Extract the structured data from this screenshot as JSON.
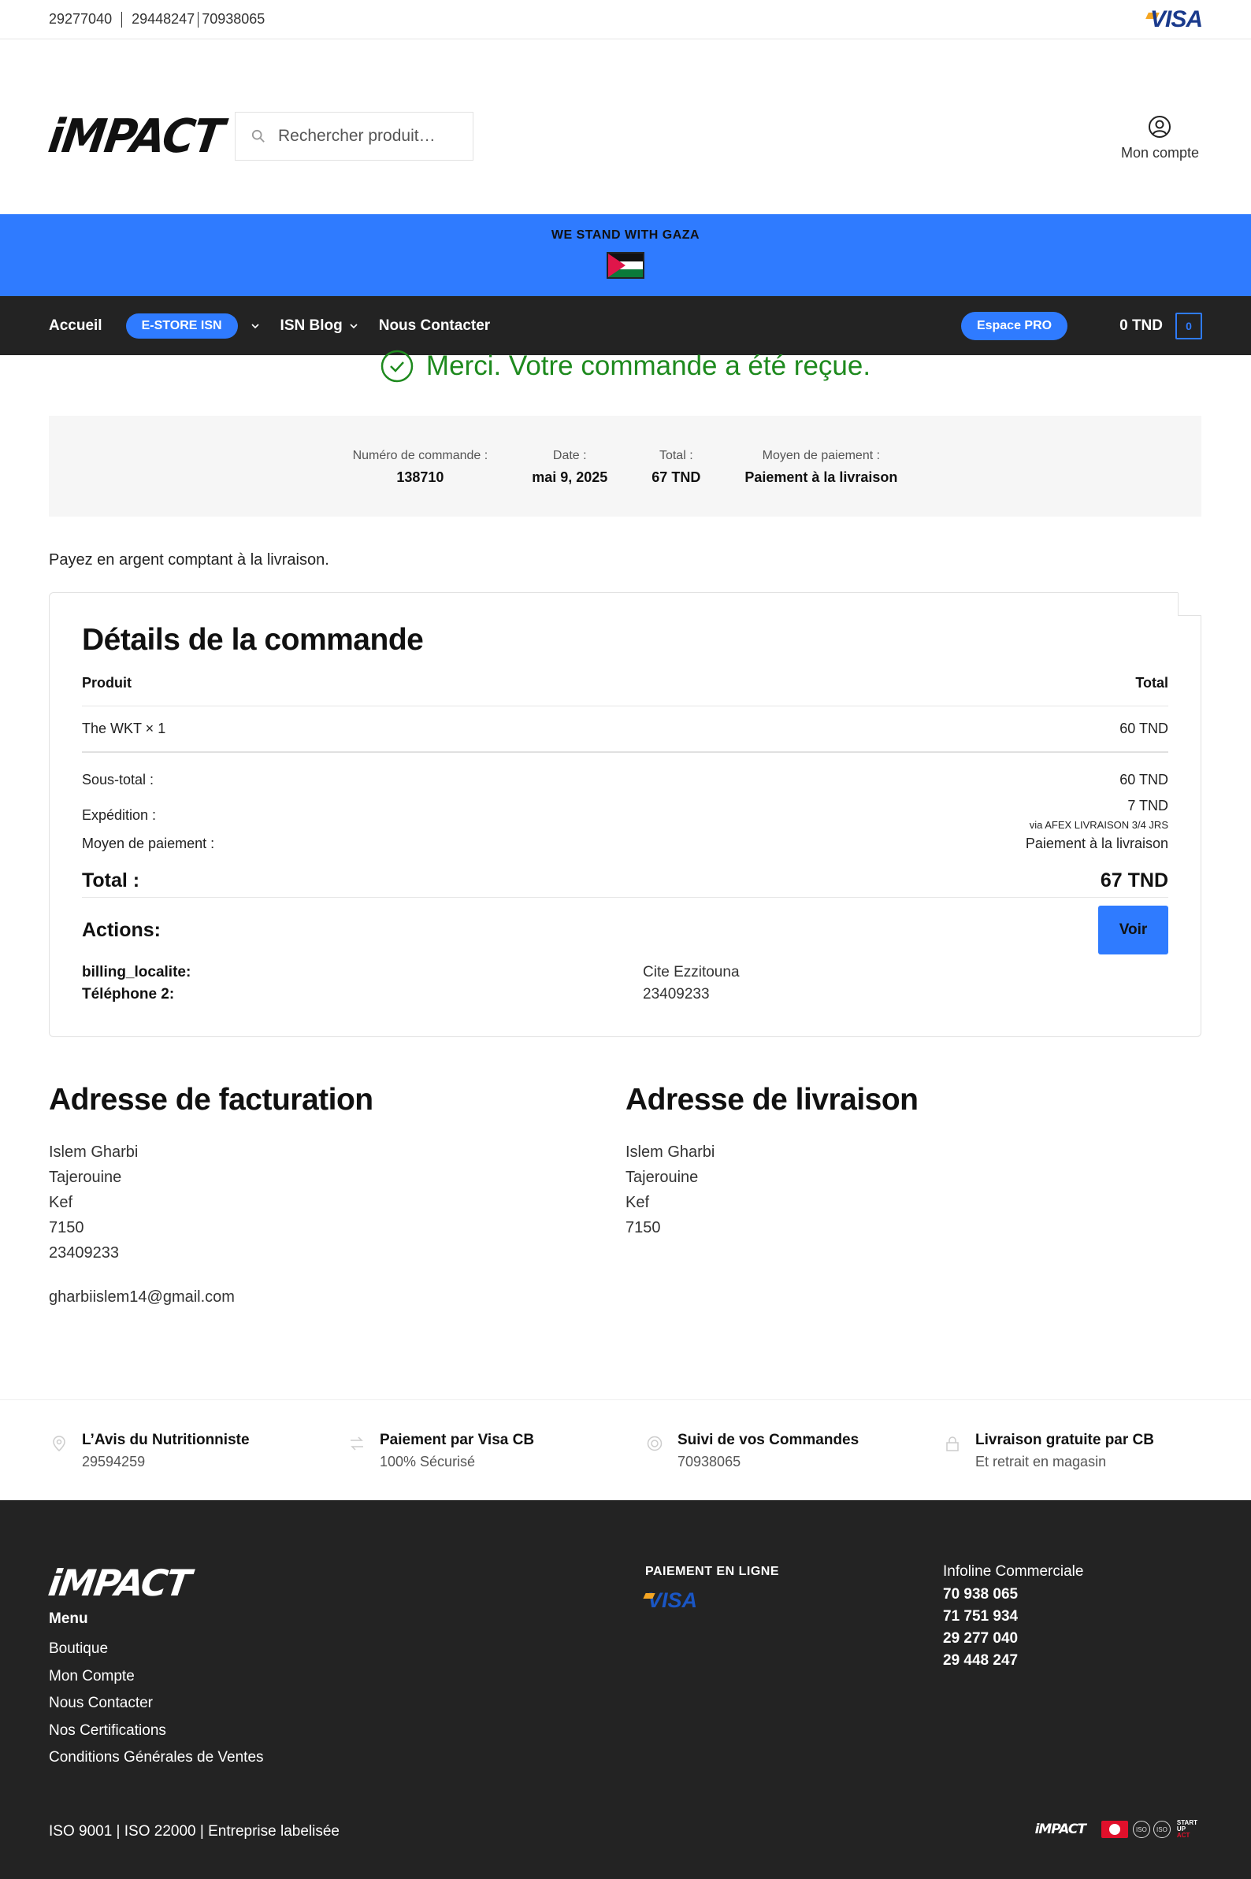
{
  "topbar": {
    "phones": [
      "29277040",
      "29448247",
      "70938065"
    ],
    "visa": "VISA"
  },
  "header": {
    "logo": "iMPACT",
    "search_placeholder": "Rechercher produit…",
    "account_label": "Mon compte"
  },
  "banner": {
    "text": "WE STAND WITH GAZA"
  },
  "nav": {
    "home": "Accueil",
    "estore": "E-STORE ISN",
    "blog": "ISN Blog",
    "contact": "Nous Contacter",
    "espace_pro": "Espace PRO",
    "cart_total": "0 TND",
    "cart_count": "0"
  },
  "order": {
    "thanks": "Merci. Votre commande a été reçue.",
    "summary": [
      {
        "label": "Numéro de commande :",
        "value": "138710"
      },
      {
        "label": "Date :",
        "value": "mai 9, 2025"
      },
      {
        "label": "Total :",
        "value": "67 TND"
      },
      {
        "label": "Moyen de paiement :",
        "value": "Paiement à la livraison"
      }
    ],
    "pay_note": "Payez en argent comptant à la livraison."
  },
  "details": {
    "title": "Détails de la commande",
    "col_product": "Produit",
    "col_total": "Total",
    "item_name": "The WKT × 1",
    "item_total": "60 TND",
    "subtotal_label": "Sous-total :",
    "subtotal_value": "60 TND",
    "shipping_label": "Expédition :",
    "shipping_value": "7 TND",
    "shipping_via": "via AFEX LIVRAISON 3/4 JRS",
    "payment_label": "Moyen de paiement :",
    "payment_value": "Paiement à la livraison",
    "total_label": "Total :",
    "total_value": "67 TND",
    "actions_label": "Actions:",
    "voir": "Voir",
    "meta": [
      {
        "key": "billing_localite:",
        "value": "Cite Ezzitouna"
      },
      {
        "key": "Téléphone 2:",
        "value": "23409233"
      }
    ]
  },
  "billing": {
    "title": "Adresse de facturation",
    "name": "Islem Gharbi",
    "city": "Tajerouine",
    "region": "Kef",
    "zip": "7150",
    "phone": "23409233",
    "email": "gharbiislem14@gmail.com"
  },
  "shipping": {
    "title": "Adresse de livraison",
    "name": "Islem Gharbi",
    "city": "Tajerouine",
    "region": "Kef",
    "zip": "7150"
  },
  "features": [
    {
      "icon": "map-pin-icon",
      "title": "L’Avis du Nutritionniste",
      "sub": "29594259"
    },
    {
      "icon": "exchange-icon",
      "title": "Paiement par Visa CB",
      "sub": "100% Sécurisé"
    },
    {
      "icon": "target-icon",
      "title": "Suivi de vos Commandes",
      "sub": "70938065"
    },
    {
      "icon": "lock-icon",
      "title": "Livraison gratuite par CB",
      "sub": "Et retrait en magasin"
    }
  ],
  "footer": {
    "logo": "iMPACT",
    "menu_title": "Menu",
    "menu": [
      "Boutique",
      "Mon Compte",
      "Nous Contacter",
      "Nos Certifications",
      "Conditions Générales de Ventes"
    ],
    "pay_title": "PAIEMENT EN LIGNE",
    "visa": "VISA",
    "infoline_label": "Infoline Commerciale",
    "infoline": [
      "70 938 065",
      "71 751 934",
      "29 277 040",
      "29 448 247"
    ],
    "iso": "ISO 9001 | ISO 22000 | Entreprise labelisée",
    "mini_logo": "iMPACT",
    "startup": [
      "START",
      "UP",
      "ACT"
    ]
  },
  "colors": {
    "accent": "#2f7bff",
    "success": "#1e8a1e",
    "dark": "#232323"
  }
}
